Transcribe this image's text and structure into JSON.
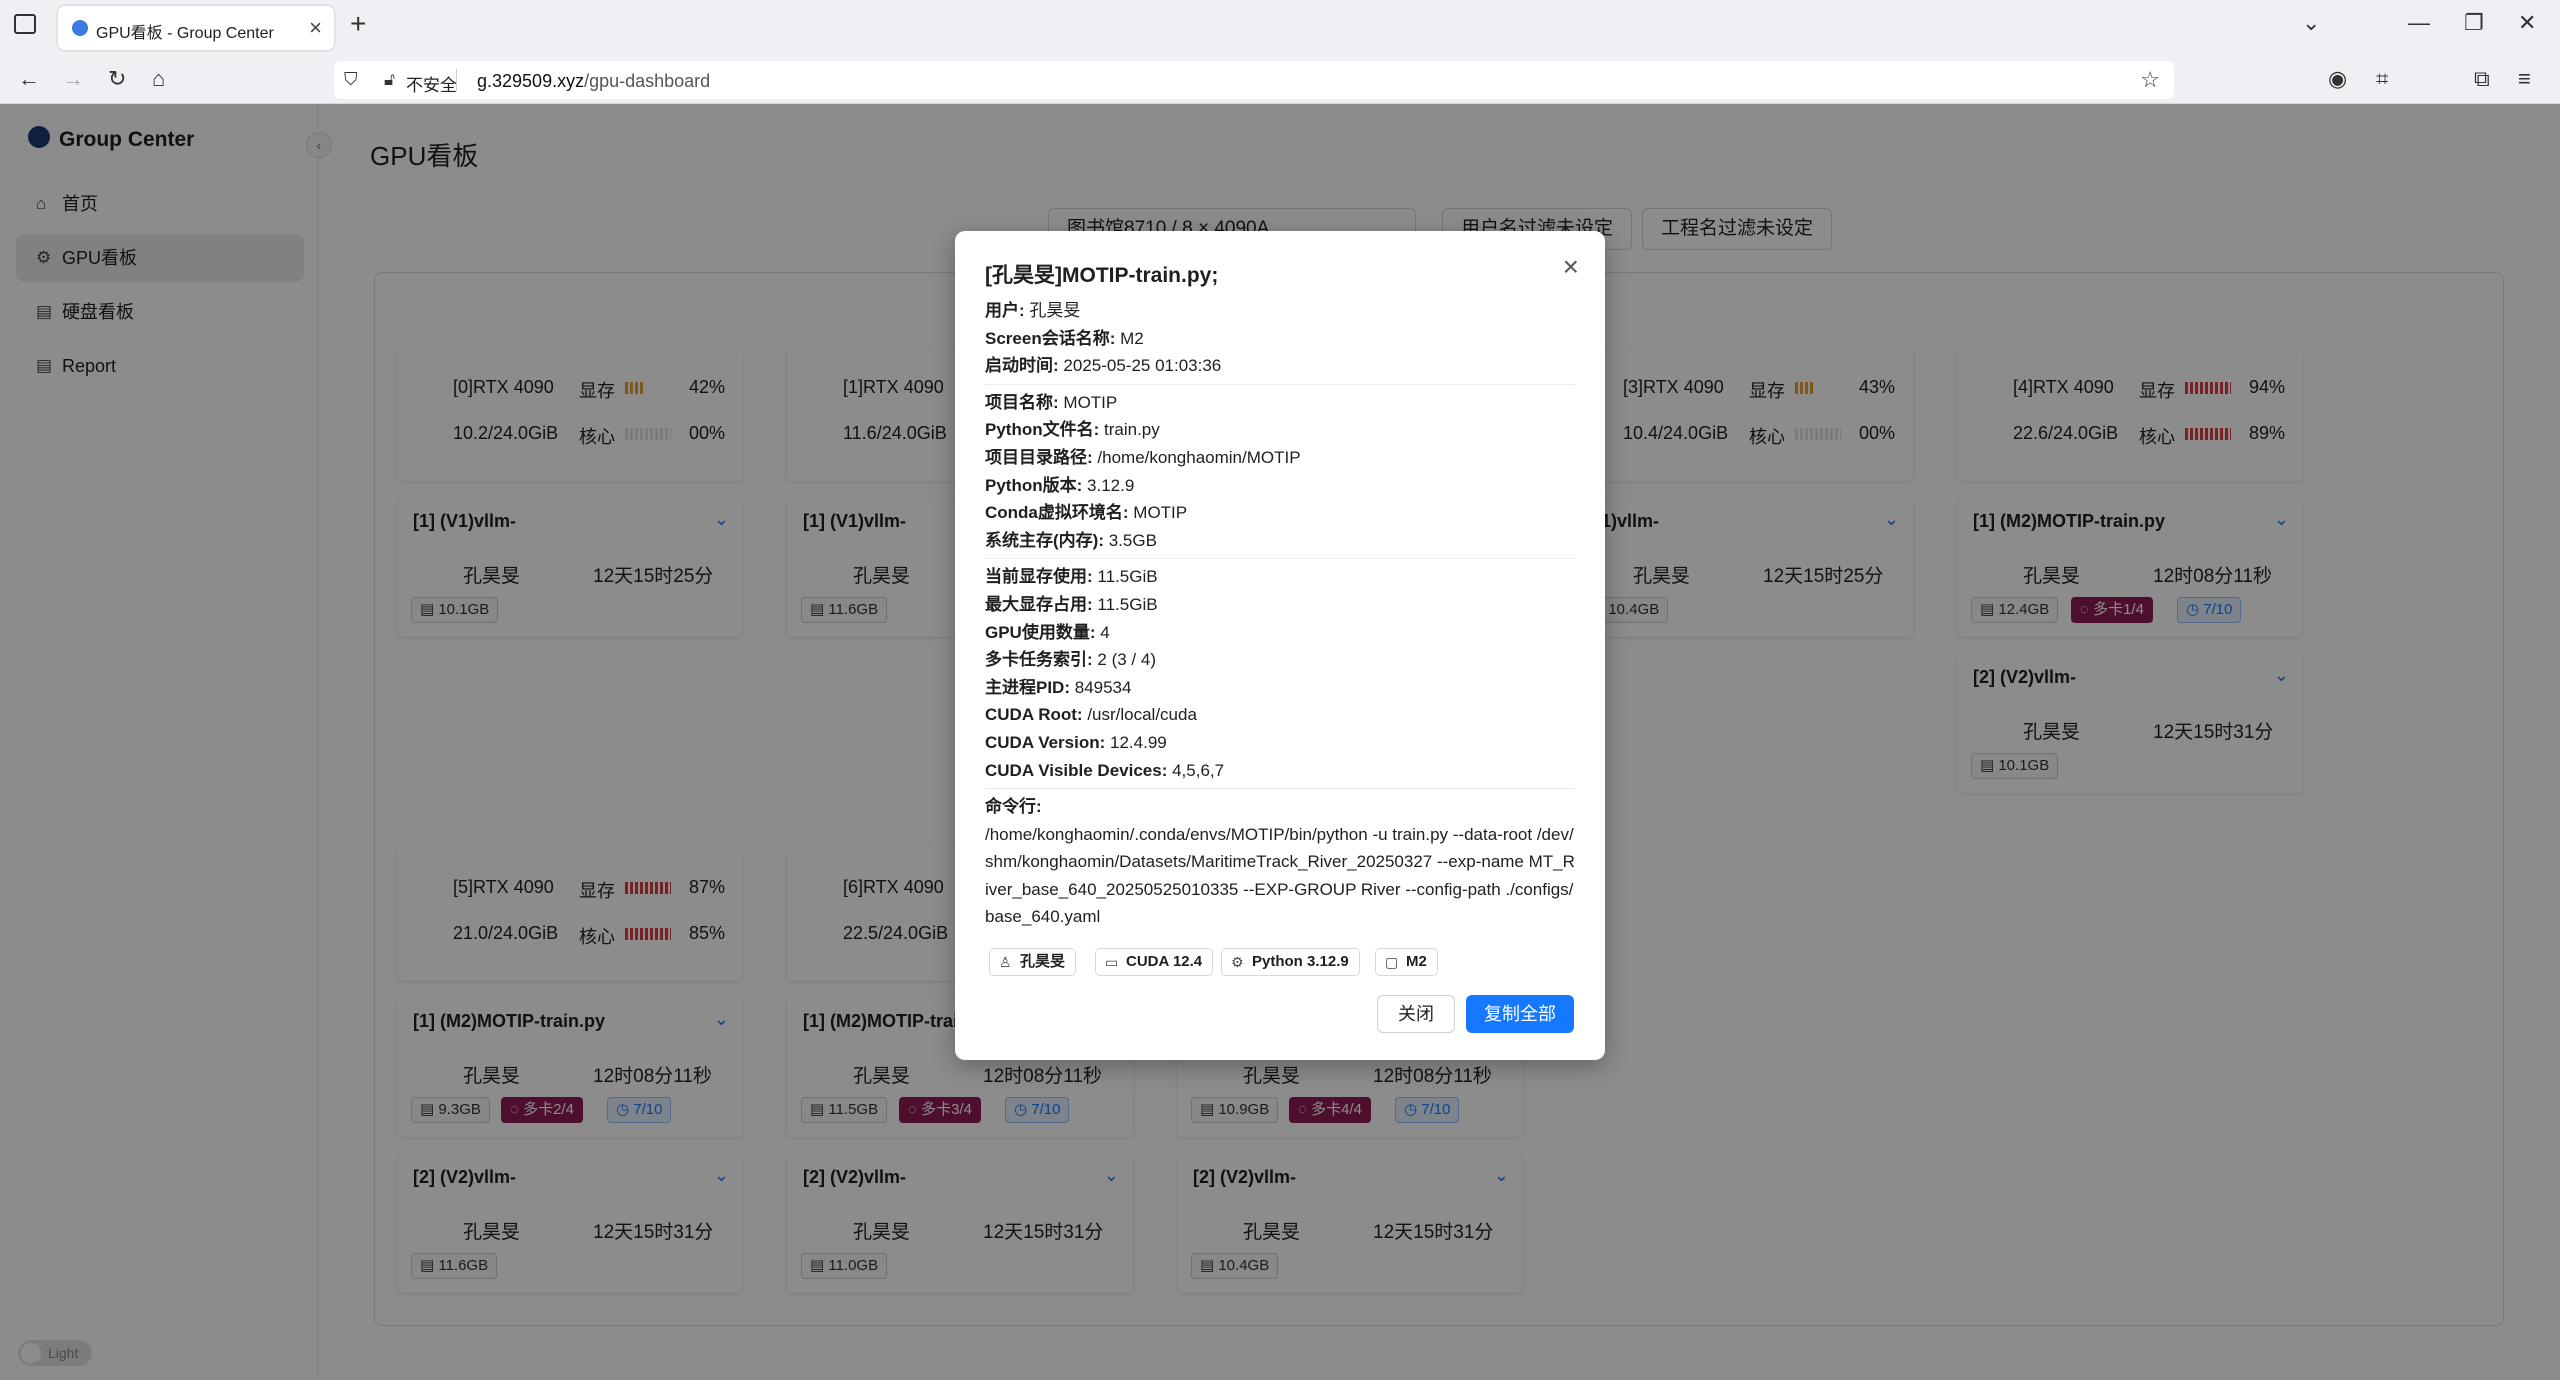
{
  "browser": {
    "tab_title": "GPU看板 - Group Center",
    "tab_close": "×",
    "new_tab": "+",
    "insecure_label": "不安全",
    "url_domain": "g.329509.xyz",
    "url_path": "/gpu-dashboard"
  },
  "sidebar": {
    "brand": "Group Center",
    "collapse": "‹",
    "items": [
      {
        "label": "首页",
        "icon": "home-icon"
      },
      {
        "label": "GPU看板",
        "icon": "gpu-icon"
      },
      {
        "label": "硬盘看板",
        "icon": "disk-icon"
      },
      {
        "label": "Report",
        "icon": "report-icon"
      }
    ],
    "theme_toggle": "Light"
  },
  "main": {
    "title": "GPU看板",
    "filters": [
      "图书馆8710 / 8 × 4090A",
      "用户名过滤未设定",
      "工程名过滤未设定"
    ],
    "mem_label": "显存",
    "core_label": "核心",
    "gpus": [
      {
        "name": "[0]RTX 4090",
        "mem": "10.2/24.0GiB",
        "mem_pct": "42%",
        "core_pct": "00%"
      },
      {
        "name": "[1]RTX 4090",
        "mem": "11.6/24.0GiB"
      },
      {
        "name": "[3]RTX 4090",
        "mem": "10.4/24.0GiB",
        "mem_pct": "43%",
        "core_pct": "00%"
      },
      {
        "name": "[4]RTX 4090",
        "mem": "22.6/24.0GiB",
        "mem_pct": "94%",
        "core_pct": "89%"
      },
      {
        "name": "[5]RTX 4090",
        "mem": "21.0/24.0GiB",
        "mem_pct": "87%",
        "core_pct": "85%"
      },
      {
        "name": "[6]RTX 4090",
        "mem": "22.5/24.0GiB"
      }
    ],
    "procs": {
      "vllm_a": {
        "title": "[1] (V1)vllm-",
        "user": "孔昊旻",
        "time": "12天15时25分",
        "mem": "10.1GB"
      },
      "vllm_b": {
        "title": "[1] (V1)vllm-",
        "user": "孔昊旻",
        "time": "",
        "mem": "11.6GB"
      },
      "vllm_c": {
        "title": "(V1)vllm-",
        "user": "孔昊旻",
        "time": "12天15时25分",
        "mem": "10.4GB"
      },
      "motip_4": {
        "title": "[1] (M2)MOTIP-train.py",
        "user": "孔昊旻",
        "time": "12时08分11秒",
        "mem": "12.4GB",
        "multi": "多卡1/4",
        "timer": "7/10"
      },
      "vllm_4b": {
        "title": "[2] (V2)vllm-",
        "user": "孔昊旻",
        "time": "12天15时31分",
        "mem": "10.1GB"
      },
      "motip_5": {
        "title": "[1] (M2)MOTIP-train.py",
        "user": "孔昊旻",
        "time": "12时08分11秒",
        "mem": "9.3GB",
        "multi": "多卡2/4",
        "timer": "7/10"
      },
      "motip_6": {
        "title": "[1] (M2)MOTIP-train",
        "user": "孔昊旻",
        "time": "12时08分11秒",
        "mem": "11.5GB",
        "multi": "多卡3/4",
        "timer": "7/10"
      },
      "motip_7": {
        "title": "",
        "user": "孔昊旻",
        "time": "12时08分11秒",
        "mem": "10.9GB",
        "multi": "多卡4/4",
        "timer": "7/10"
      },
      "vllm_5b": {
        "title": "[2] (V2)vllm-",
        "user": "孔昊旻",
        "time": "12天15时31分",
        "mem": "11.6GB"
      },
      "vllm_6b": {
        "title": "[2] (V2)vllm-",
        "user": "孔昊旻",
        "time": "12天15时31分",
        "mem": "11.0GB"
      },
      "vllm_7b": {
        "title": "[2] (V2)vllm-",
        "user": "孔昊旻",
        "time": "12天15时31分",
        "mem": "10.4GB"
      }
    }
  },
  "modal": {
    "title": "[孔昊旻]MOTIP-train.py;",
    "close_x": "×",
    "group1": [
      {
        "k": "用户:",
        "v": "孔昊旻"
      },
      {
        "k": "Screen会话名称:",
        "v": "M2"
      },
      {
        "k": "启动时间:",
        "v": "2025-05-25 01:03:36"
      }
    ],
    "group2": [
      {
        "k": "项目名称:",
        "v": "MOTIP"
      },
      {
        "k": "Python文件名:",
        "v": "train.py"
      },
      {
        "k": "项目目录路径:",
        "v": "/home/konghaomin/MOTIP"
      },
      {
        "k": "Python版本:",
        "v": "3.12.9"
      },
      {
        "k": "Conda虚拟环境名:",
        "v": "MOTIP"
      },
      {
        "k": "系统主存(内存):",
        "v": "3.5GB"
      }
    ],
    "group3": [
      {
        "k": "当前显存使用:",
        "v": "11.5GiB"
      },
      {
        "k": "最大显存占用:",
        "v": "11.5GiB"
      },
      {
        "k": "GPU使用数量:",
        "v": "4"
      },
      {
        "k": "多卡任务索引:",
        "v": "2 (3 / 4)"
      },
      {
        "k": "主进程PID:",
        "v": "849534"
      },
      {
        "k": "CUDA Root:",
        "v": "/usr/local/cuda"
      },
      {
        "k": "CUDA Version:",
        "v": "12.4.99"
      },
      {
        "k": "CUDA Visible Devices:",
        "v": "4,5,6,7"
      }
    ],
    "cmd_label": "命令行:",
    "cmd": "/home/konghaomin/.conda/envs/MOTIP/bin/python -u train.py --data-root /dev/shm/konghaomin/Datasets/MaritimeTrack_River_20250327 --exp-name MT_River_base_640_20250525010335 --EXP-GROUP River --config-path ./configs/base_640.yaml",
    "chips": [
      {
        "label": "孔昊旻",
        "icon": "user-icon"
      },
      {
        "label": "CUDA 12.4",
        "icon": "video-icon"
      },
      {
        "label": "Python 3.12.9",
        "icon": "python-icon"
      },
      {
        "label": "M2",
        "icon": "screen-icon"
      }
    ],
    "btn_close": "关闭",
    "btn_copy": "复制全部"
  },
  "colors": {
    "accent": "#1677ff",
    "multi_tag": "#8e1c54",
    "bar_low": "#e3951b",
    "bar_high": "#d9262a"
  }
}
